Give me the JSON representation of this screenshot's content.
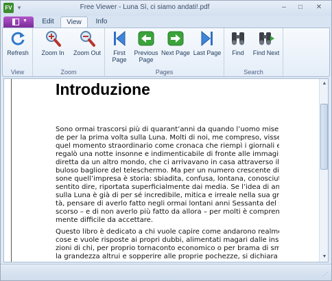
{
  "window": {
    "title": "Free Viewer - Luna Sì, ci siamo andati!.pdf",
    "app_icon_text": "FV",
    "minimize": "–",
    "maximize": "□",
    "close": "✕",
    "qat_glyph": "▾"
  },
  "tabs": {
    "file_glyph": "▼",
    "items": [
      "Edit",
      "View",
      "Info"
    ],
    "active": "View"
  },
  "ribbon": {
    "groups": {
      "view": {
        "label": "View",
        "buttons": [
          {
            "label": "Refresh",
            "icon": "refresh-icon"
          }
        ]
      },
      "zoom": {
        "label": "Zoom",
        "buttons": [
          {
            "label": "Zoom In",
            "icon": "zoom-in-icon"
          },
          {
            "label": "Zoom Out",
            "icon": "zoom-out-icon"
          }
        ]
      },
      "pages": {
        "label": "Pages",
        "buttons": [
          {
            "line1": "First",
            "line2": "Page",
            "icon": "first-page-icon"
          },
          {
            "line1": "Previous",
            "line2": "Page",
            "icon": "previous-page-icon"
          },
          {
            "line1": "Next Page",
            "line2": "",
            "icon": "next-page-icon"
          },
          {
            "line1": "Last Page",
            "line2": "",
            "icon": "last-page-icon"
          }
        ]
      },
      "search": {
        "label": "Search",
        "buttons": [
          {
            "label": "Find",
            "icon": "find-icon"
          },
          {
            "label": "Find Next",
            "icon": "find-next-icon"
          }
        ]
      }
    }
  },
  "colors": {
    "accent_purple": "#8e35ad",
    "nav_blue": "#2f6fc4",
    "nav_green": "#3aa33a"
  },
  "document": {
    "heading": "Introduzione",
    "paragraph1": [
      "Sono ormai trascorsi più di quarant’anni da quando l’uomo mise pie-",
      "de per la prima volta sulla Luna. Molti di noi, me compreso, vissero",
      "quel momento straordinario come cronaca che riempì i giornali e ci",
      "regalò una notte insonne e indimenticabile di fronte alle immagini, in",
      "diretta da un altro mondo, che ci arrivavano in casa attraverso il ne-",
      "buloso bagliore del teleschermo. Ma per un numero crescente di per-",
      "sone quell’impresa è storia: sbiadita, confusa, lontana, conosciuta per",
      "sentito dire, riportata superficialmente dai media. Se l’idea di andare",
      "sulla Luna è già di per sé incredibile, mitica e irreale nella sua grandiosi-",
      "tà, pensare di averlo fatto negli ormai lontani anni Sessanta del secolo",
      "scorso – e di non averlo più fatto da allora – per molti è comprensibil-",
      "mente difficile da accettare."
    ],
    "paragraph2": [
      "Questo libro è dedicato a chi vuole capire come andarono realmente le",
      "cose e vuole risposte ai propri dubbi, alimentati magari dalle insinua-",
      "zioni di chi, per proprio tornaconto economico o per brama di sminuire",
      "la grandezza altrui e sopperire alle proprie pochezze, si dichiara rabbio-"
    ]
  },
  "scrollbar": {
    "up": "▲",
    "down": "▼"
  },
  "statusbar": {
    "grip": "⋰"
  }
}
